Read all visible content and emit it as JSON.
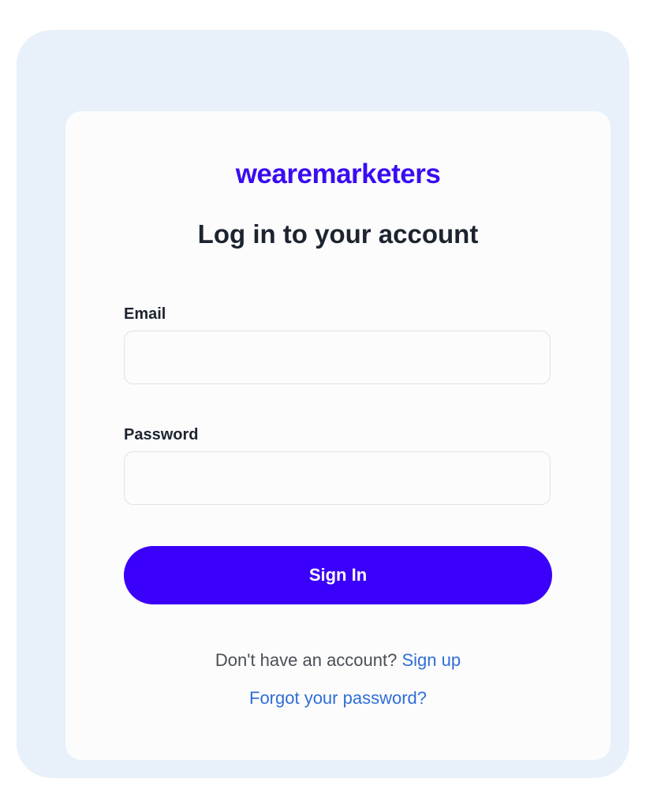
{
  "brand": {
    "logo_text": "wearemarketers",
    "accent_color": "#3a00f9"
  },
  "form": {
    "title": "Log in to your account",
    "email": {
      "label": "Email",
      "value": "",
      "placeholder": ""
    },
    "password": {
      "label": "Password",
      "value": "",
      "placeholder": ""
    },
    "submit_label": "Sign In"
  },
  "footer": {
    "no_account_text": "Don't have an account?",
    "signup_link": "Sign up",
    "forgot_link": "Forgot your password?",
    "link_color": "#2f6ed8"
  }
}
